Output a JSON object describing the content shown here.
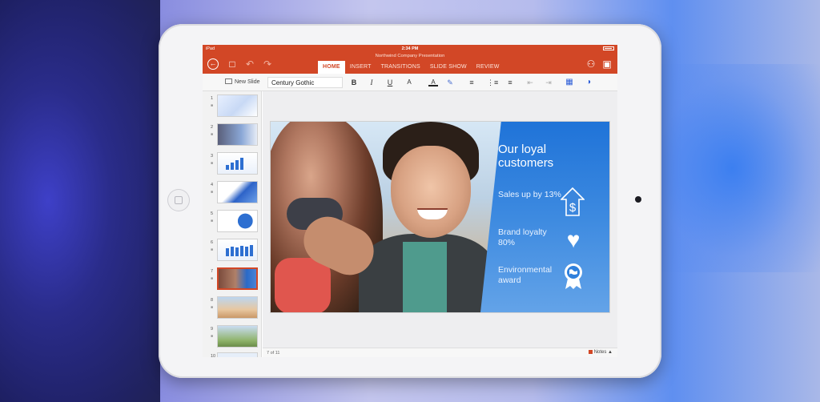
{
  "statusbar": {
    "carrier": "iPad",
    "time": "2:34 PM"
  },
  "document": {
    "title": "Northwind Company Presentation"
  },
  "toolbar_icons": {
    "back": "back-icon",
    "file": "file-icon",
    "undo": "undo-icon",
    "redo": "redo-icon",
    "share": "share-icon",
    "present": "present-icon"
  },
  "tabs": [
    {
      "label": "HOME",
      "active": true
    },
    {
      "label": "INSERT"
    },
    {
      "label": "TRANSITIONS"
    },
    {
      "label": "SLIDE SHOW"
    },
    {
      "label": "REVIEW"
    }
  ],
  "formatting": {
    "new_slide_label": "New Slide",
    "font_name": "Century Gothic",
    "bold": "B",
    "italic": "I",
    "underline": "U",
    "font_size": "A",
    "font_color": "A"
  },
  "thumbnails": [
    {
      "number": "1"
    },
    {
      "number": "2"
    },
    {
      "number": "3"
    },
    {
      "number": "4"
    },
    {
      "number": "5"
    },
    {
      "number": "6"
    },
    {
      "number": "7",
      "selected": true
    },
    {
      "number": "8"
    },
    {
      "number": "9"
    },
    {
      "number": "10"
    }
  ],
  "slide": {
    "title": "Our loyal customers",
    "features": [
      {
        "text": "Sales up by 13%",
        "icon": "dollar-house-icon"
      },
      {
        "text": "Brand loyalty 80%",
        "icon": "heart-icon"
      },
      {
        "text": "Environmental award",
        "icon": "globe-ribbon-icon"
      }
    ]
  },
  "bottom_bar": {
    "page_count": "7 of 11",
    "notes_label": "Notes"
  },
  "colors": {
    "accent": "#d24726",
    "slide_panel": "#2f80dc"
  }
}
